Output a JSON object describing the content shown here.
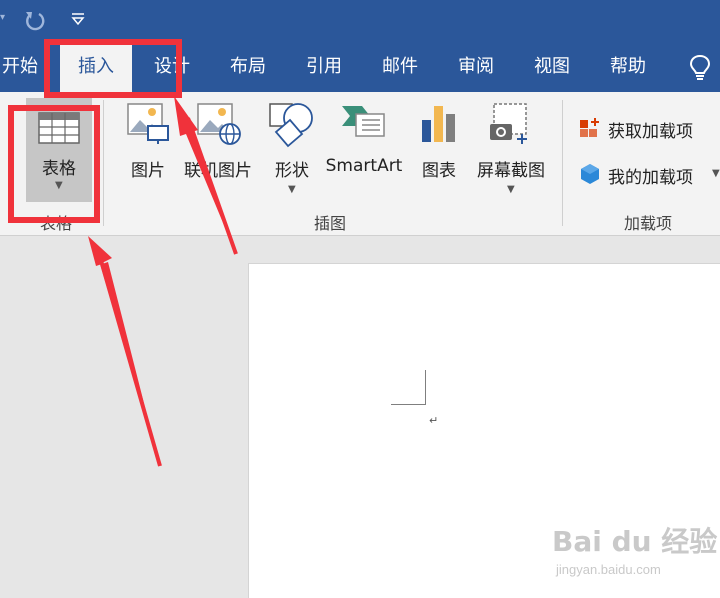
{
  "tabs": [
    {
      "label": "开始"
    },
    {
      "label": "插入"
    },
    {
      "label": "设计"
    },
    {
      "label": "布局"
    },
    {
      "label": "引用"
    },
    {
      "label": "邮件"
    },
    {
      "label": "审阅"
    },
    {
      "label": "视图"
    },
    {
      "label": "帮助"
    }
  ],
  "active_tab": "插入",
  "ribbon": {
    "table": {
      "label": "表格",
      "group": "表格"
    },
    "illustrations": {
      "group": "插图",
      "picture": "图片",
      "online_picture": "联机图片",
      "shapes": "形状",
      "smartart": "SmartArt",
      "chart": "图表",
      "screenshot": "屏幕截图"
    },
    "addins": {
      "group": "加载项",
      "get_addins": "获取加载项",
      "my_addins": "我的加载项"
    }
  },
  "document": {
    "paragraph_mark": "↵"
  },
  "watermark": {
    "brand": "Bai du 经验",
    "url": "jingyan.baidu.com"
  },
  "colors": {
    "ribbon_blue": "#2b579a",
    "annotation_red": "#f0323b"
  },
  "icons": [
    "undo-icon",
    "customize-dropdown-icon",
    "lightbulb-icon",
    "table-icon",
    "picture-icon",
    "online-picture-icon",
    "shapes-icon",
    "smartart-icon",
    "chart-icon",
    "screenshot-icon",
    "store-icon",
    "my-addins-icon"
  ]
}
